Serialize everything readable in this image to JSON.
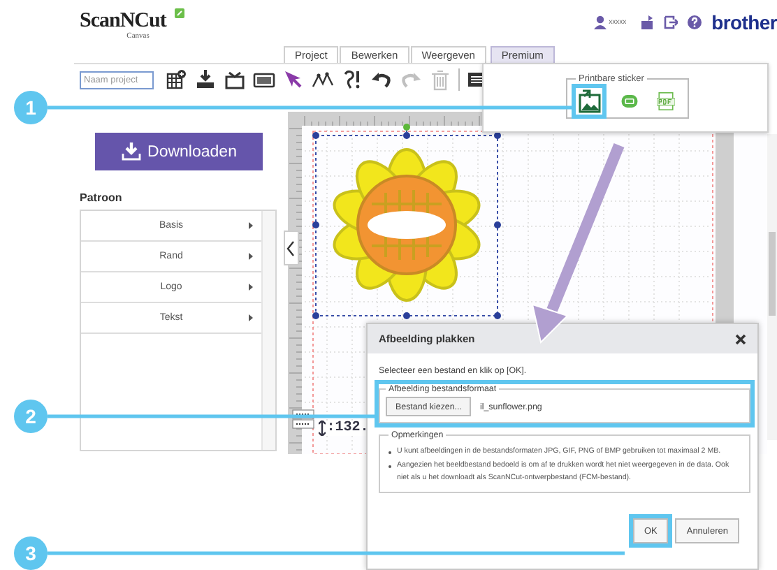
{
  "header": {
    "logo": "ScanNCut",
    "logo_sub": "Canvas",
    "user": "xxxxx",
    "brand": "brother"
  },
  "tabs": [
    {
      "label": "Project",
      "selected": false
    },
    {
      "label": "Bewerken",
      "selected": false
    },
    {
      "label": "Weergeven",
      "selected": false
    },
    {
      "label": "Premium",
      "selected": true
    }
  ],
  "toolbar": {
    "project_name": {
      "placeholder": "Naam project"
    },
    "tools": [
      {
        "kind": "grid-add",
        "disabled": false
      },
      {
        "kind": "download",
        "disabled": false
      },
      {
        "kind": "import",
        "disabled": false
      },
      {
        "kind": "file",
        "disabled": false
      },
      {
        "kind": "select",
        "disabled": false
      },
      {
        "kind": "path",
        "disabled": false
      },
      {
        "kind": "trace",
        "disabled": false
      },
      {
        "kind": "undo",
        "disabled": false
      },
      {
        "kind": "redo",
        "disabled": true
      },
      {
        "kind": "delete",
        "disabled": true
      },
      {
        "kind": "list",
        "disabled": false
      }
    ]
  },
  "premium_panel": {
    "group_title": "Printbare sticker",
    "tools": [
      {
        "kind": "image",
        "highlighted": true
      },
      {
        "kind": "label",
        "highlighted": false
      },
      {
        "kind": "pdf",
        "highlighted": false
      }
    ]
  },
  "download_button": "Downloaden",
  "pattern_panel": {
    "title": "Patroon",
    "items": [
      {
        "label": "Basis"
      },
      {
        "label": "Rand"
      },
      {
        "label": "Logo"
      },
      {
        "label": "Tekst"
      }
    ]
  },
  "canvas": {
    "readout": ":132."
  },
  "dialog": {
    "title": "Afbeelding plakken",
    "instruction": "Selecteer een bestand en klik op [OK].",
    "file_group": {
      "legend": "Afbeelding bestandsformaat",
      "choose_button": "Bestand kiezen...",
      "file_name": "il_sunflower.png",
      "highlighted": true
    },
    "notes": {
      "legend": "Opmerkingen",
      "items": [
        "U kunt afbeeldingen in de bestandsformaten JPG, GIF, PNG of BMP gebruiken tot maximaal 2 MB.",
        "Aangezien het beeldbestand bedoeld is om af te drukken wordt het niet weergegeven in de data. Ook niet als u het downloadt als ScanNCut-ontwerpbestand (FCM-bestand)."
      ]
    },
    "buttons": [
      {
        "label": "OK",
        "highlighted": true
      },
      {
        "label": "Annuleren",
        "highlighted": false
      }
    ]
  },
  "callouts": [
    {
      "number": "1"
    },
    {
      "number": "2"
    },
    {
      "number": "3"
    }
  ]
}
